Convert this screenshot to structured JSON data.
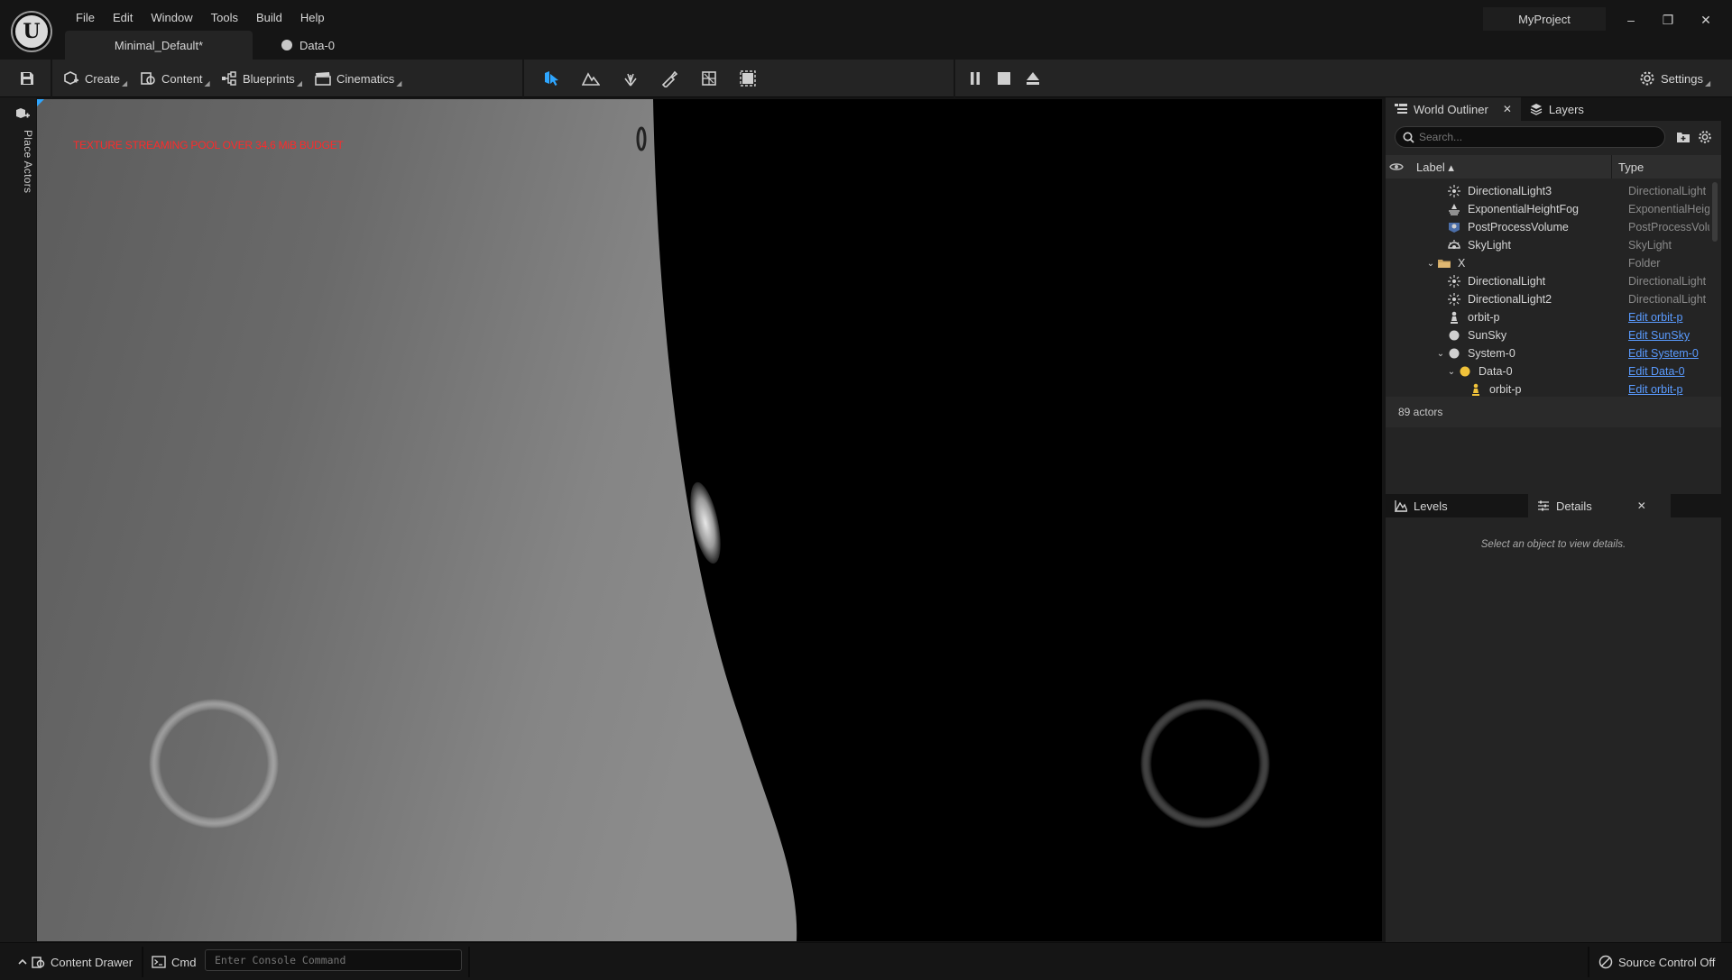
{
  "menu": [
    "File",
    "Edit",
    "Window",
    "Tools",
    "Build",
    "Help"
  ],
  "project_name": "MyProject",
  "window_controls": {
    "minimize": "–",
    "restore": "❐",
    "close": "✕"
  },
  "doc_tabs": [
    {
      "label": "Minimal_Default*"
    },
    {
      "label": "Data-0"
    }
  ],
  "toolbar": {
    "create": "Create",
    "content": "Content",
    "blueprints": "Blueprints",
    "cinematics": "Cinematics",
    "settings": "Settings",
    "mode_icons": [
      "select-mode-icon",
      "landscape-mode-icon",
      "foliage-mode-icon",
      "mesh-paint-mode-icon",
      "fracture-mode-icon",
      "modeling-mode-icon"
    ],
    "play_icons": [
      "pause-icon",
      "stop-icon",
      "eject-icon"
    ],
    "accent": "#2ea6ff"
  },
  "left_strip": {
    "label": "Place Actors"
  },
  "viewport": {
    "warning": "TEXTURE STREAMING POOL OVER 34.6 MiB BUDGET",
    "warning_color": "#ff2a2a"
  },
  "outliner": {
    "tab_label": "World Outliner",
    "layers_tab": "Layers",
    "search_placeholder": "Search...",
    "col_label": "Label ▴",
    "col_type": "Type",
    "rows": [
      {
        "name": "DirectionalLight3",
        "type": "DirectionalLight",
        "icon": "directional-light-icon",
        "link": false
      },
      {
        "name": "ExponentialHeightFog",
        "type": "ExponentialHeightFog",
        "icon": "fog-icon",
        "link": false
      },
      {
        "name": "PostProcessVolume",
        "type": "PostProcessVolume",
        "icon": "post-process-icon",
        "link": false
      },
      {
        "name": "SkyLight",
        "type": "SkyLight",
        "icon": "skylight-icon",
        "link": false
      },
      {
        "name": "X",
        "type": "Folder",
        "icon": "folder-icon",
        "link": false,
        "expander": "⌄"
      },
      {
        "name": "DirectionalLight",
        "type": "DirectionalLight",
        "icon": "directional-light-icon",
        "link": false
      },
      {
        "name": "DirectionalLight2",
        "type": "DirectionalLight",
        "icon": "directional-light-icon",
        "link": false
      },
      {
        "name": "orbit-p",
        "type": "Edit orbit-p",
        "icon": "pawn-icon",
        "link": true
      },
      {
        "name": "SunSky",
        "type": "Edit SunSky",
        "icon": "sphere-icon",
        "link": true
      },
      {
        "name": "System-0",
        "type": "Edit System-0",
        "icon": "sphere-icon",
        "link": true,
        "expander": "⌄"
      },
      {
        "name": "Data-0",
        "type": "Edit Data-0",
        "icon": "sphere-yellow-icon",
        "link": true,
        "expander": "⌄"
      },
      {
        "name": "orbit-p",
        "type": "Edit orbit-p",
        "icon": "pawn-yellow-icon",
        "link": true
      }
    ],
    "actor_count": "89 actors"
  },
  "details": {
    "levels_tab": "Levels",
    "details_tab": "Details",
    "empty_message": "Select an object to view details."
  },
  "statusbar": {
    "content_drawer": "Content Drawer",
    "cmd": "Cmd",
    "console_placeholder": "Enter Console Command",
    "source_control": "Source Control Off"
  }
}
